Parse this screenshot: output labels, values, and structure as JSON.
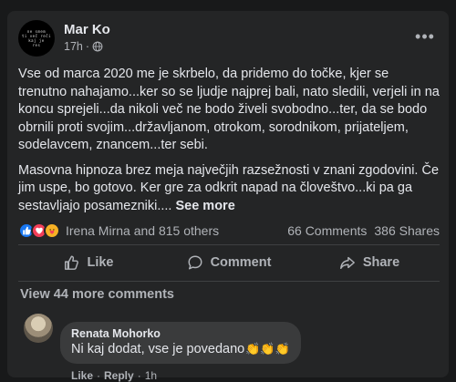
{
  "post": {
    "author": "Mar Ko",
    "time": "17h",
    "avatar_text": "ne smem\nti več reči\nkaj je\nres",
    "privacy_icon": "globe-icon",
    "paragraph1": "Vse od marca 2020 me je skrbelo, da pridemo do točke, kjer se trenutno nahajamo...ker so se ljudje najprej bali, nato sledili, verjeli in na koncu sprejeli...da nikoli več ne bodo živeli svobodno...ter, da se bodo obrnili proti svojim...državljanom, otrokom, sorodnikom, prijateljem, sodelavcem, znancem...ter sebi.",
    "paragraph2": "Masovna hipnoza brez meja največjih razsežnosti v znani zgodovini. Če jim uspe, bo gotovo. Ker gre za odkrit napad na človeštvo...ki pa ga sestavljajo posamezniki....",
    "see_more": "See more"
  },
  "reactions": {
    "icons": [
      "like",
      "love",
      "care"
    ],
    "summary": "Irena Mirna and 815 others",
    "comments": "66 Comments",
    "shares": "386 Shares"
  },
  "actions": {
    "like": "Like",
    "comment": "Comment",
    "share": "Share"
  },
  "comments": {
    "view_more": "View 44 more comments",
    "items": [
      {
        "name": "Renata Mohorko",
        "text": "Ni kaj dodat, vse je povedano",
        "emoji": "👏👏👏",
        "like": "Like",
        "reply": "Reply",
        "time": "1h"
      }
    ]
  },
  "colors": {
    "background": "#18191a",
    "card": "#242526",
    "bubble": "#3a3b3c",
    "text": "#e4e6eb",
    "secondary": "#b0b3b8",
    "like_blue": "#1877f2",
    "love_red": "#f33e58"
  }
}
